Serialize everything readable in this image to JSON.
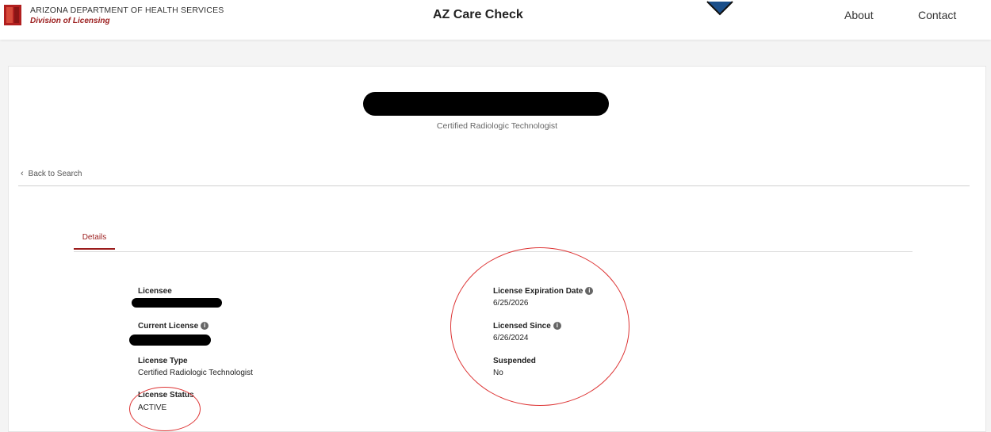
{
  "header": {
    "org_name": "ARIZONA DEPARTMENT OF HEALTH SERVICES",
    "org_division": "Division of Licensing",
    "site_title": "AZ Care Check",
    "nav": {
      "about": "About",
      "contact": "Contact"
    }
  },
  "profile": {
    "subtitle": "Certified Radiologic Technologist"
  },
  "back_link": "Back to Search",
  "tabs": {
    "details": "Details"
  },
  "details": {
    "licensee_label": "Licensee",
    "current_license_label": "Current License",
    "license_type_label": "License Type",
    "license_type_value": "Certified Radiologic Technologist",
    "license_status_label": "License Status",
    "license_status_value": "ACTIVE",
    "expiration_label": "License Expiration Date",
    "expiration_value": "6/25/2026",
    "since_label": "Licensed Since",
    "since_value": "6/26/2024",
    "suspended_label": "Suspended",
    "suspended_value": "No"
  },
  "colors": {
    "accent": "#9b1c1c",
    "annotation": "#d33"
  },
  "icons": {
    "info": "info-icon",
    "back": "chevron-left-icon"
  }
}
